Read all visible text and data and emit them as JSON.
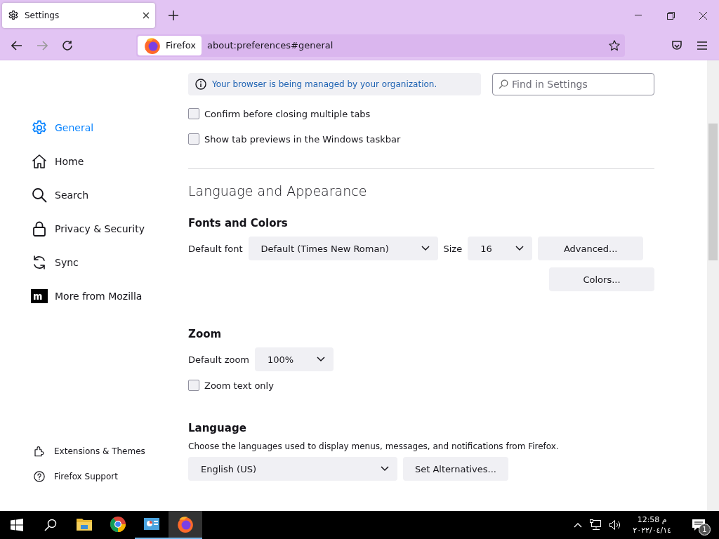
{
  "window": {
    "tab": {
      "title": "Settings",
      "selected": true
    },
    "url_bar": {
      "identity": "Firefox",
      "url": "about:preferences#general"
    }
  },
  "sidebar": {
    "items": [
      {
        "label": "General",
        "kind": "gear",
        "selected": true
      },
      {
        "label": "Home",
        "kind": "home",
        "selected": false
      },
      {
        "label": "Search",
        "kind": "search",
        "selected": false
      },
      {
        "label": "Privacy & Security",
        "kind": "lock",
        "selected": false
      },
      {
        "label": "Sync",
        "kind": "sync",
        "selected": false
      },
      {
        "label": "More from Mozilla",
        "kind": "mozilla",
        "selected": false
      }
    ],
    "footer": [
      {
        "label": "Extensions & Themes",
        "kind": "puzzle"
      },
      {
        "label": "Firefox Support",
        "kind": "help"
      }
    ]
  },
  "notice": "Your browser is being managed by your organization.",
  "search": {
    "placeholder": "Find in Settings"
  },
  "tab_options": [
    {
      "label": "Confirm before closing multiple tabs",
      "checked": false
    },
    {
      "label": "Show tab previews in the Windows taskbar",
      "checked": false
    }
  ],
  "section_title": "Language and Appearance",
  "fonts": {
    "heading": "Fonts and Colors",
    "default_font_label": "Default font",
    "default_font": "Default (Times New Roman)",
    "size_label": "Size",
    "size": "16",
    "buttons": [
      "Advanced...",
      "Colors..."
    ]
  },
  "zoom": {
    "heading": "Zoom",
    "label": "Default zoom",
    "value": "100%",
    "text_only": {
      "label": "Zoom text only",
      "checked": false
    }
  },
  "language": {
    "heading": "Language",
    "description": "Choose the languages used to display menus, messages, and notifications from Firefox.",
    "value": "English (US)",
    "button": "Set Alternatives..."
  },
  "taskbar": {
    "apps": [
      {
        "kind": "folder",
        "running": false,
        "active": false
      },
      {
        "kind": "chrome",
        "running": false,
        "active": false
      },
      {
        "kind": "control",
        "running": true,
        "active": false
      },
      {
        "kind": "firefox",
        "running": true,
        "active": true
      }
    ],
    "time": "12:58 م",
    "date": "٢٠٢٢/٠٤/١٤",
    "notifications": "1"
  }
}
